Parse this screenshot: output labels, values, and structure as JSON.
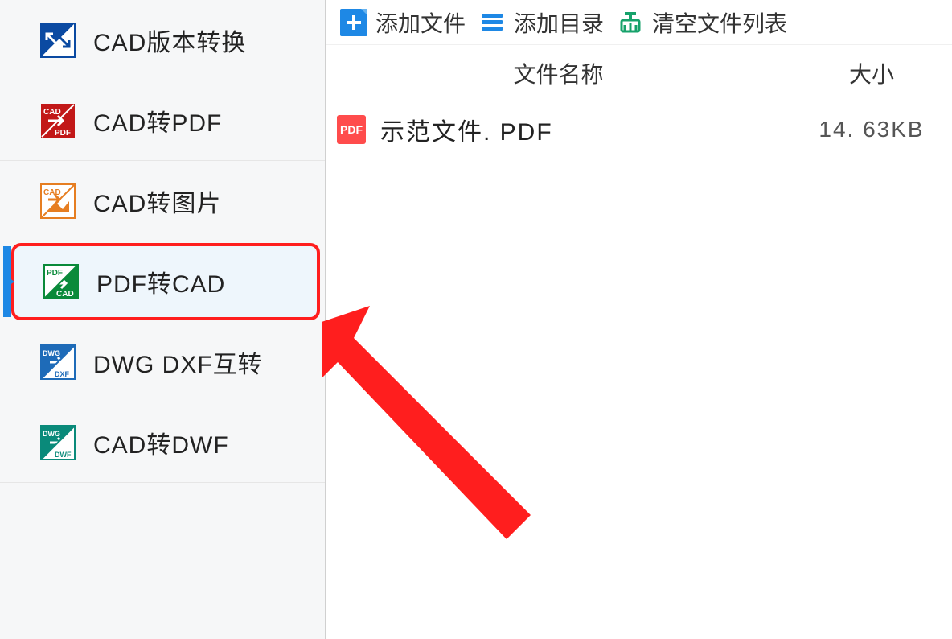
{
  "sidebar": {
    "items": [
      {
        "label": "CAD版本转换"
      },
      {
        "label": "CAD转PDF"
      },
      {
        "label": "CAD转图片"
      },
      {
        "label": "PDF转CAD"
      },
      {
        "label": "DWG DXF互转"
      },
      {
        "label": "CAD转DWF"
      }
    ]
  },
  "toolbar": {
    "add_file": "添加文件",
    "add_dir": "添加目录",
    "clear_list": "清空文件列表"
  },
  "table": {
    "header_name": "文件名称",
    "header_size": "大小",
    "rows": [
      {
        "icon_text": "PDF",
        "name": "示范文件. PDF",
        "size": "14. 63KB"
      }
    ]
  }
}
